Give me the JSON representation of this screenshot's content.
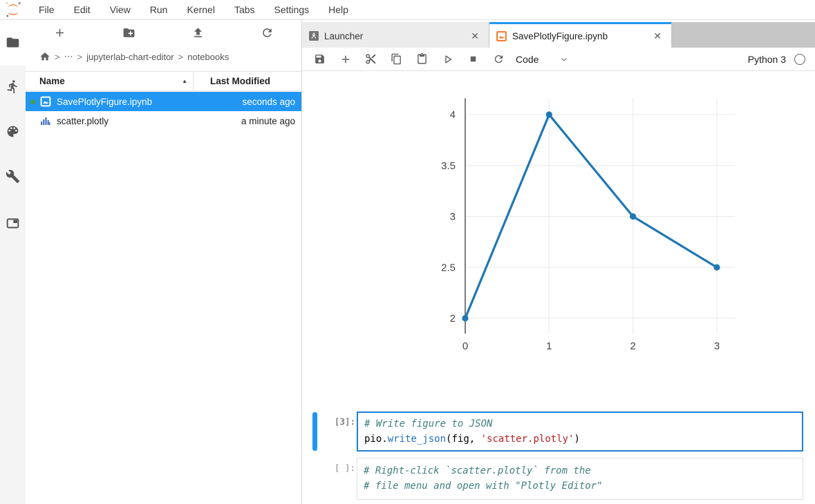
{
  "menu": {
    "items": [
      "File",
      "Edit",
      "View",
      "Run",
      "Kernel",
      "Tabs",
      "Settings",
      "Help"
    ]
  },
  "sidebar": {
    "icons": [
      "file-browser",
      "running-sessions",
      "commands-palette",
      "extensions-tools",
      "open-tabs"
    ],
    "active": "file-browser"
  },
  "filebrowser": {
    "toolbar_buttons": [
      "new-launcher",
      "new-folder",
      "upload",
      "refresh"
    ],
    "breadcrumb": {
      "separator": ">",
      "ellipsis": "⋯",
      "items": [
        "jupyterlab-chart-editor",
        "notebooks"
      ]
    },
    "columns": {
      "name": "Name",
      "modified": "Last Modified",
      "sort_indicator": "▲"
    },
    "files": [
      {
        "name": "SavePlotlyFigure.ipynb",
        "modified": "seconds ago",
        "icon": "notebook-icon",
        "selected": true,
        "running": true
      },
      {
        "name": "scatter.plotly",
        "modified": "a minute ago",
        "icon": "plotly-file-icon",
        "selected": false,
        "running": false
      }
    ]
  },
  "main": {
    "tabs": [
      {
        "label": "Launcher",
        "icon": "launcher-icon",
        "close": "✕",
        "active": false
      },
      {
        "label": "SavePlotlyFigure.ipynb",
        "icon": "notebook-icon",
        "close": "✕",
        "active": true
      }
    ],
    "toolbar": {
      "buttons": [
        "save",
        "insert-cell",
        "cut",
        "copy",
        "paste",
        "run",
        "stop",
        "restart-kernel"
      ],
      "cell_type": "Code",
      "kernel_name": "Python 3",
      "kernel_status": "idle"
    }
  },
  "chart_data": {
    "type": "line",
    "mode": "lines+markers",
    "x": [
      0,
      1,
      2,
      3
    ],
    "y": [
      2,
      4,
      3,
      2.5
    ],
    "xticks": [
      0,
      1,
      2,
      3
    ],
    "yticks": [
      2,
      2.5,
      3,
      3.5,
      4
    ],
    "xlim": [
      0,
      3.217
    ],
    "ylim": [
      1.85,
      4.16
    ],
    "grid": true,
    "line_color": "#1f77b4",
    "title": "",
    "xlabel": "",
    "ylabel": "",
    "legend": "none"
  },
  "cells": [
    {
      "prompt": "[3]:",
      "active": true,
      "code": [
        [
          {
            "t": "# Write figure to JSON",
            "c": "comment"
          }
        ],
        [
          {
            "t": "pio",
            "c": "plain"
          },
          {
            "t": ".",
            "c": "plain"
          },
          {
            "t": "write_json",
            "c": "property"
          },
          {
            "t": "(fig, ",
            "c": "plain"
          },
          {
            "t": "'scatter.plotly'",
            "c": "string"
          },
          {
            "t": ")",
            "c": "plain"
          }
        ]
      ]
    },
    {
      "prompt": "[ ]:",
      "active": false,
      "code": [
        [
          {
            "t": "# Right-click `scatter.plotly` from the",
            "c": "comment"
          }
        ],
        [
          {
            "t": "# file menu and open with \"Plotly Editor\"",
            "c": "comment"
          }
        ]
      ]
    }
  ],
  "colors": {
    "accent": "#2196f3",
    "jupyter_orange": "#f37726",
    "chart_line": "#1f77b4",
    "running_dot": "#43a047",
    "comment": "#408080",
    "string": "#ba2121",
    "property": "#2170c0",
    "tabbar_gray": "#c6c6c6"
  }
}
